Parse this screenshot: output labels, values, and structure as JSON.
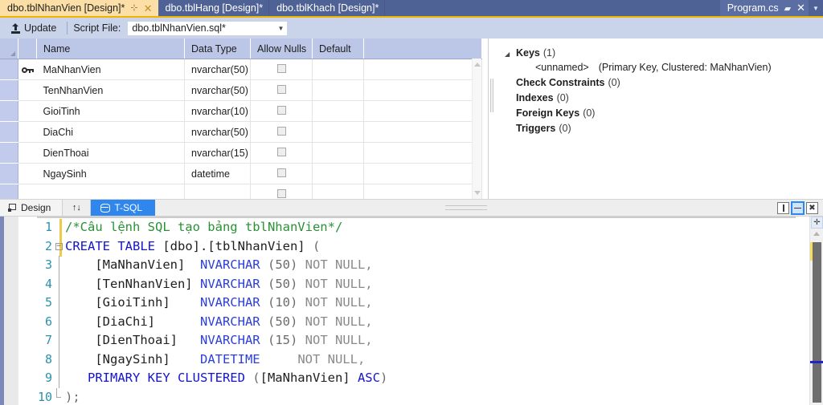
{
  "window": {
    "tabs": [
      {
        "label": "dbo.tblNhanVien [Design]*",
        "active": true,
        "pin_icon": "pin-icon",
        "close_icon": "close-icon"
      },
      {
        "label": "dbo.tblHang [Design]*",
        "active": false
      },
      {
        "label": "dbo.tblKhach [Design]*",
        "active": false
      }
    ],
    "right_tab": {
      "label": "Program.cs",
      "pin_icon": "pin-icon",
      "close_icon": "close-icon",
      "dropdown_icon": "chevron-down-icon"
    },
    "accent_color": "#f0b400",
    "tabbar_color": "#4f6296",
    "active_tab_color": "#fcdfa6"
  },
  "toolbar": {
    "update_label": "Update",
    "update_icon": "update-arrow-icon",
    "script_file_label": "Script File:",
    "script_file_value": "dbo.tblNhanVien.sql*",
    "dropdown_icon": "chevron-down-icon"
  },
  "grid": {
    "columns": [
      "Name",
      "Data Type",
      "Allow Nulls",
      "Default",
      ""
    ],
    "rows": [
      {
        "key": true,
        "name": "MaNhanVien",
        "type": "nvarchar(50)",
        "allow_nulls": false,
        "default": ""
      },
      {
        "key": false,
        "name": "TenNhanVien",
        "type": "nvarchar(50)",
        "allow_nulls": false,
        "default": ""
      },
      {
        "key": false,
        "name": "GioiTinh",
        "type": "nvarchar(10)",
        "allow_nulls": false,
        "default": ""
      },
      {
        "key": false,
        "name": "DiaChi",
        "type": "nvarchar(50)",
        "allow_nulls": false,
        "default": ""
      },
      {
        "key": false,
        "name": "DienThoai",
        "type": "nvarchar(15)",
        "allow_nulls": false,
        "default": ""
      },
      {
        "key": false,
        "name": "NgaySinh",
        "type": "datetime",
        "allow_nulls": false,
        "default": ""
      },
      {
        "key": false,
        "name": "",
        "type": "",
        "allow_nulls": false,
        "default": ""
      }
    ]
  },
  "keys_panel": {
    "nodes": [
      {
        "label": "Keys",
        "count": "(1)",
        "expanded": true
      },
      {
        "label": "Check Constraints",
        "count": "(0)",
        "expanded": false
      },
      {
        "label": "Indexes",
        "count": "(0)",
        "expanded": false
      },
      {
        "label": "Foreign Keys",
        "count": "(0)",
        "expanded": false
      },
      {
        "label": "Triggers",
        "count": "(0)",
        "expanded": false
      }
    ],
    "key_child": {
      "name": "<unnamed>",
      "detail": "(Primary Key, Clustered: MaNhanVien)"
    },
    "twisty_icon": "triangle-down-icon"
  },
  "view_tabs": {
    "design_label": "Design",
    "design_icon": "design-icon",
    "swap_label": "↑↓",
    "swap_icon": "swap-panes-icon",
    "tsql_label": "T-SQL",
    "tsql_icon": "database-icon",
    "selected": "T-SQL",
    "pane_buttons": [
      {
        "name": "vertical-split",
        "active": false
      },
      {
        "name": "horizontal-split",
        "active": true
      },
      {
        "name": "maximize-pane",
        "active": false
      }
    ]
  },
  "editor": {
    "lines": [
      {
        "no": "1",
        "fold": "none",
        "tokens": [
          {
            "t": "comment",
            "s": "/*Câu lệnh SQL tạo bảng tblNhanVien*/"
          }
        ]
      },
      {
        "no": "2",
        "fold": "start",
        "tokens": [
          {
            "t": "kw",
            "s": "CREATE TABLE "
          },
          {
            "t": "id",
            "s": "[dbo].[tblNhanVien] "
          },
          {
            "t": "punct",
            "s": "("
          }
        ]
      },
      {
        "no": "3",
        "fold": "bar",
        "tokens": [
          {
            "t": "id",
            "s": "    [MaNhanVien]  "
          },
          {
            "t": "type",
            "s": "NVARCHAR "
          },
          {
            "t": "num",
            "s": "(50) "
          },
          {
            "t": "gray",
            "s": "NOT NULL,"
          }
        ]
      },
      {
        "no": "4",
        "fold": "bar",
        "tokens": [
          {
            "t": "id",
            "s": "    [TenNhanVien] "
          },
          {
            "t": "type",
            "s": "NVARCHAR "
          },
          {
            "t": "num",
            "s": "(50) "
          },
          {
            "t": "gray",
            "s": "NOT NULL,"
          }
        ]
      },
      {
        "no": "5",
        "fold": "bar",
        "tokens": [
          {
            "t": "id",
            "s": "    [GioiTinh]    "
          },
          {
            "t": "type",
            "s": "NVARCHAR "
          },
          {
            "t": "num",
            "s": "(10) "
          },
          {
            "t": "gray",
            "s": "NOT NULL,"
          }
        ]
      },
      {
        "no": "6",
        "fold": "bar",
        "tokens": [
          {
            "t": "id",
            "s": "    [DiaChi]      "
          },
          {
            "t": "type",
            "s": "NVARCHAR "
          },
          {
            "t": "num",
            "s": "(50) "
          },
          {
            "t": "gray",
            "s": "NOT NULL,"
          }
        ]
      },
      {
        "no": "7",
        "fold": "bar",
        "tokens": [
          {
            "t": "id",
            "s": "    [DienThoai]   "
          },
          {
            "t": "type",
            "s": "NVARCHAR "
          },
          {
            "t": "num",
            "s": "(15) "
          },
          {
            "t": "gray",
            "s": "NOT NULL,"
          }
        ]
      },
      {
        "no": "8",
        "fold": "bar",
        "tokens": [
          {
            "t": "id",
            "s": "    [NgaySinh]    "
          },
          {
            "t": "type",
            "s": "DATETIME     "
          },
          {
            "t": "gray",
            "s": "NOT NULL,"
          }
        ]
      },
      {
        "no": "9",
        "fold": "bar",
        "tokens": [
          {
            "t": "kw",
            "s": "   PRIMARY KEY CLUSTERED "
          },
          {
            "t": "punct",
            "s": "("
          },
          {
            "t": "id",
            "s": "[MaNhanVien] "
          },
          {
            "t": "kw",
            "s": "ASC"
          },
          {
            "t": "punct",
            "s": ")"
          }
        ]
      },
      {
        "no": "10",
        "fold": "end",
        "tokens": [
          {
            "t": "punct",
            "s": ");"
          }
        ]
      }
    ],
    "scrollbar": {
      "split_handle_icon": "split-editor-icon",
      "up_arrow_icon": "arrow-up-icon",
      "change_marker_color": "#f3df5e",
      "caret_marker_color": "#2323c8"
    }
  }
}
